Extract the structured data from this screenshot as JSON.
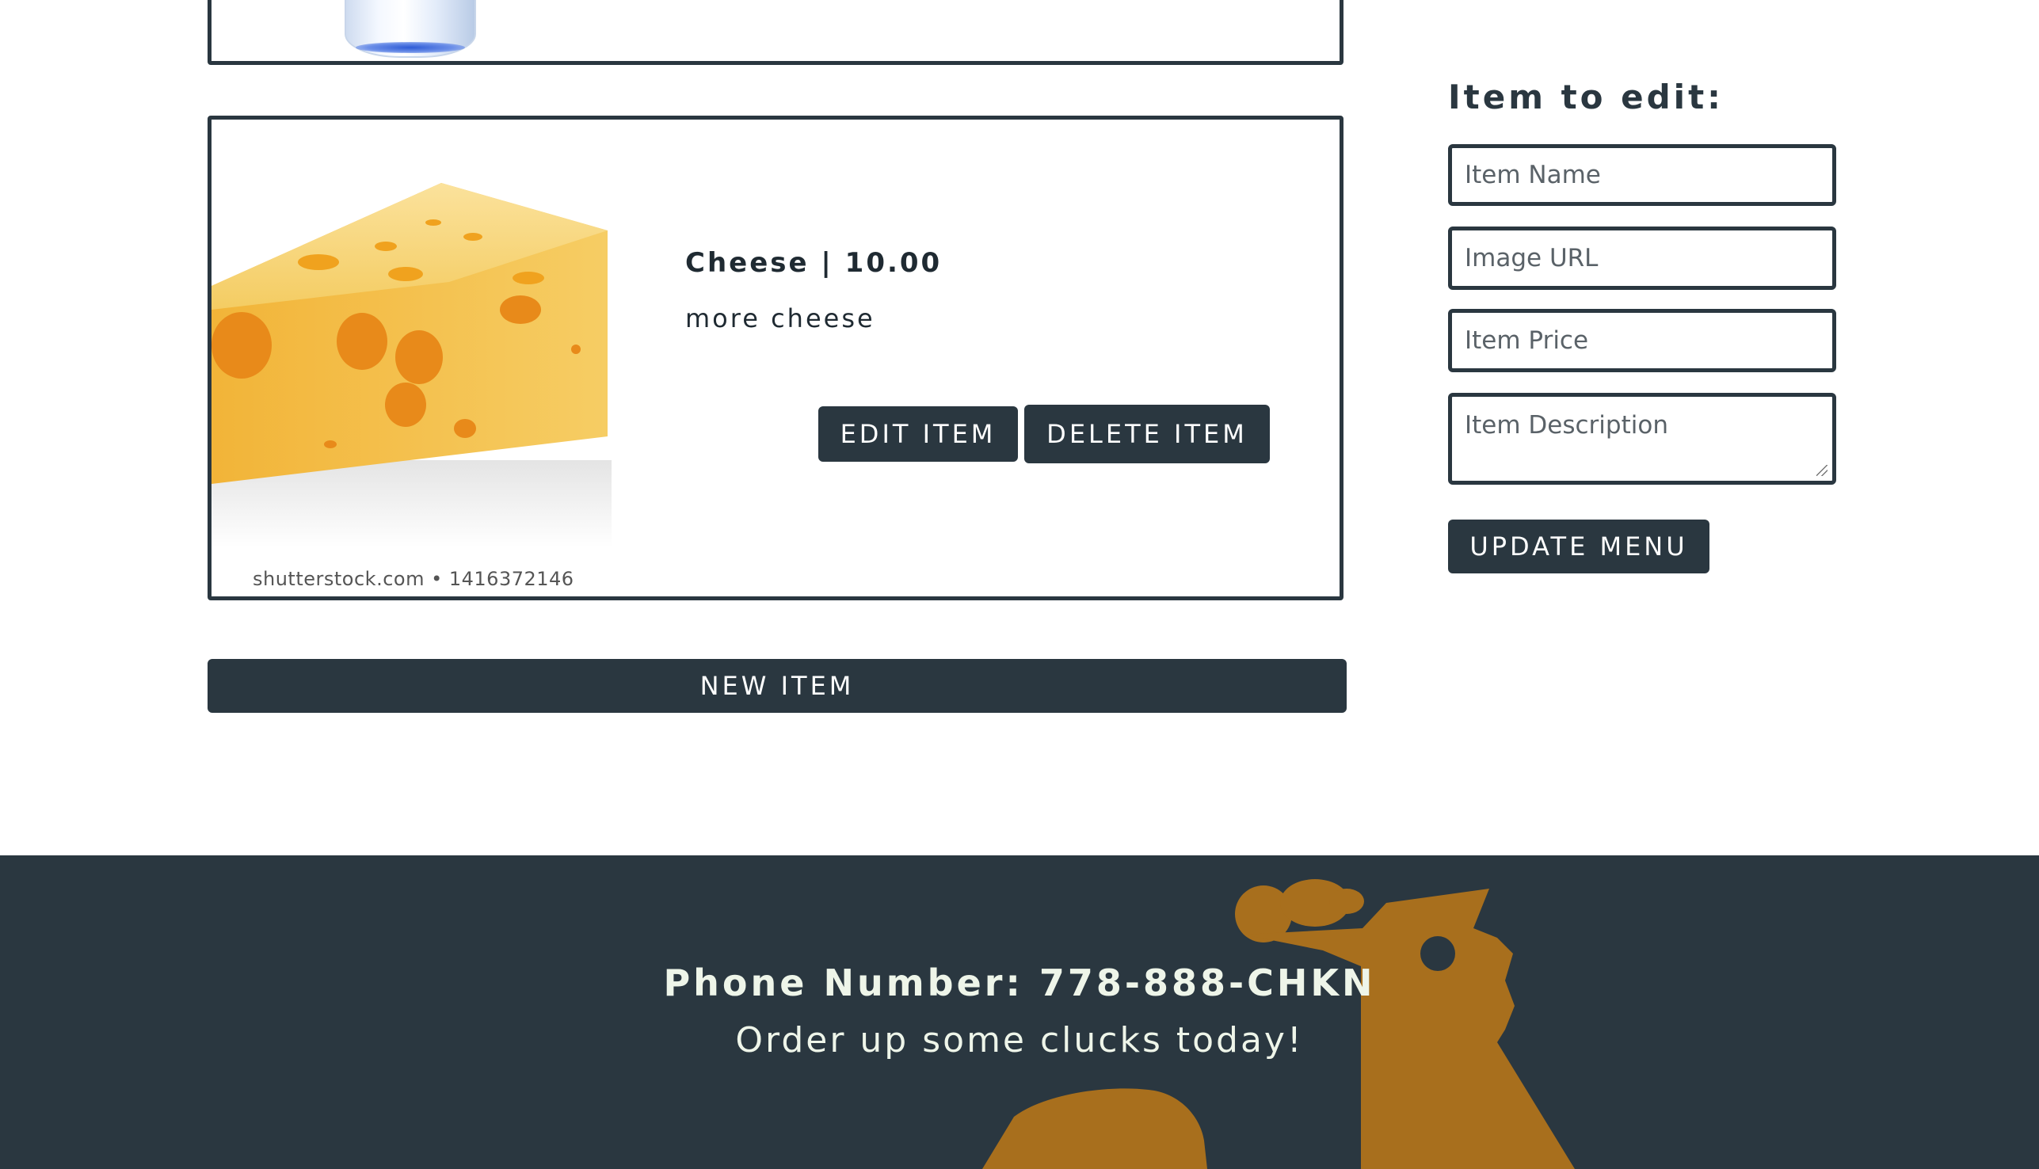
{
  "menu": {
    "items": [
      {
        "name": "Cheese",
        "price": "10.00",
        "title": "Cheese | 10.00",
        "description": "more cheese",
        "image_watermark": "shutterstock.com • 1416372146"
      }
    ],
    "edit_label": "EDIT ITEM",
    "delete_label": "DELETE ITEM",
    "new_item_label": "NEW ITEM"
  },
  "editor": {
    "heading": "Item to edit:",
    "name_placeholder": "Item Name",
    "url_placeholder": "Image URL",
    "price_placeholder": "Item Price",
    "description_placeholder": "Item Description",
    "update_label": "UPDATE MENU"
  },
  "footer": {
    "phone": "Phone Number: 778-888-CHKN",
    "tagline": "Order up some clucks today!"
  },
  "colors": {
    "primary": "#2a3740",
    "accent": "#a86f1d",
    "footer_text": "#eef5e9"
  }
}
